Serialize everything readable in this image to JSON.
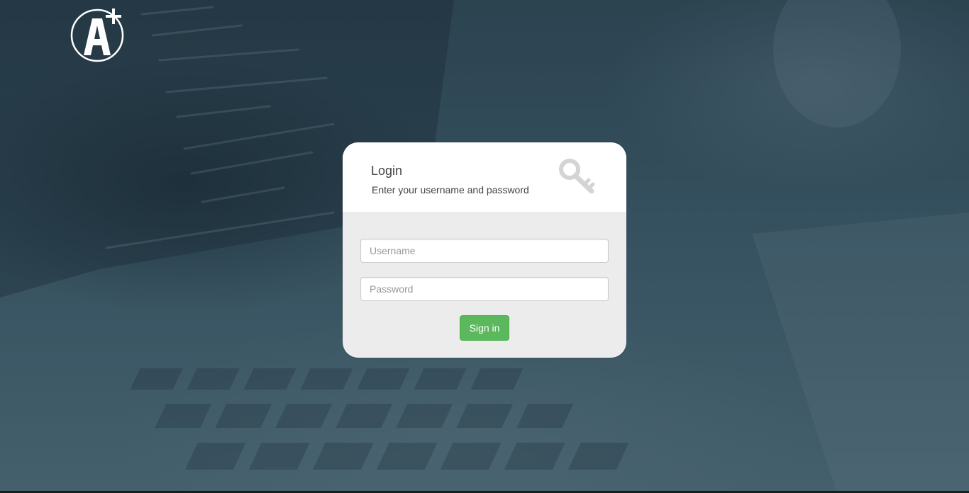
{
  "login": {
    "title": "Login",
    "subtitle": "Enter your username and password",
    "username_placeholder": "Username",
    "username_value": "",
    "password_placeholder": "Password",
    "password_value": "",
    "signin_label": "Sign in",
    "header_icon": "key-icon"
  },
  "branding": {
    "logo_icon": "a-plus-logo-icon"
  },
  "colors": {
    "background": "#3a5260",
    "card_header": "#ffffff",
    "card_body": "#ececec",
    "signin_button": "#5cb85c",
    "logo": "#ffffff",
    "key_icon": "#d4d4d4"
  }
}
